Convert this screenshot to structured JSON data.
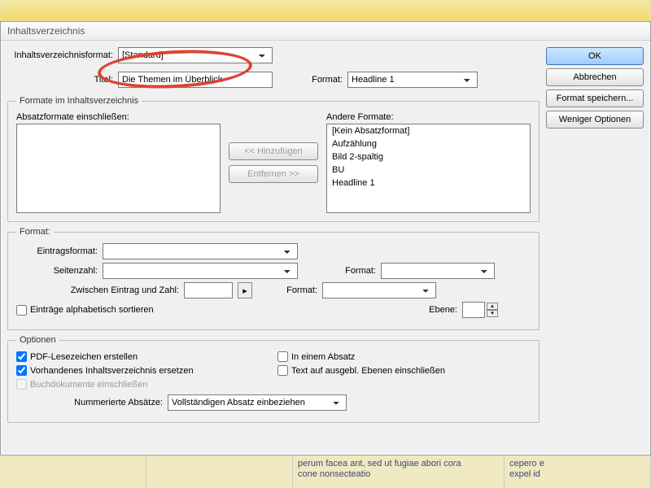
{
  "window_title": "Inhaltsverzeichnis",
  "top": {
    "format_lbl": "Inhaltsverzeichnisformat:",
    "format_val": "[Standard]",
    "title_lbl": "Titel:",
    "title_val": "Die Themen im Überblick",
    "style_lbl": "Format:",
    "style_val": "Headline 1"
  },
  "formats_group": {
    "legend": "Formate im Inhaltsverzeichnis",
    "include_lbl": "Absatzformate einschließen:",
    "other_lbl": "Andere Formate:",
    "add_btn": "<< Hinzufügen",
    "remove_btn": "Entfernen >>",
    "other_items": [
      "[Kein Absatzformat]",
      "Aufzählung",
      "Bild 2-spaltig",
      "BU",
      "Headline 1"
    ]
  },
  "format_group": {
    "legend": "Format:",
    "entry_lbl": "Eintragsformat:",
    "page_lbl": "Seitenzahl:",
    "between_lbl": "Zwischen Eintrag und Zahl:",
    "fmt_lbl": "Format:",
    "level_lbl": "Ebene:",
    "sort_lbl": "Einträge alphabetisch sortieren"
  },
  "options_group": {
    "legend": "Optionen",
    "pdf_lbl": "PDF-Lesezeichen erstellen",
    "replace_lbl": "Vorhandenes Inhaltsverzeichnis ersetzen",
    "book_lbl": "Buchdokumente einschließen",
    "para_lbl": "In einem Absatz",
    "hidden_lbl": "Text auf ausgebl. Ebenen einschließen",
    "numbered_lbl": "Nummerierte Absätze:",
    "numbered_val": "Vollständigen Absatz einbeziehen"
  },
  "side": {
    "ok": "OK",
    "cancel": "Abbrechen",
    "save": "Format speichern...",
    "less": "Weniger Optionen"
  },
  "backdrop": {
    "line1": "perum facea ant, sed ut fugiae abori cora",
    "line2": "cone nonsecteatio",
    "line3": "cepero e",
    "line4": "expel id"
  }
}
